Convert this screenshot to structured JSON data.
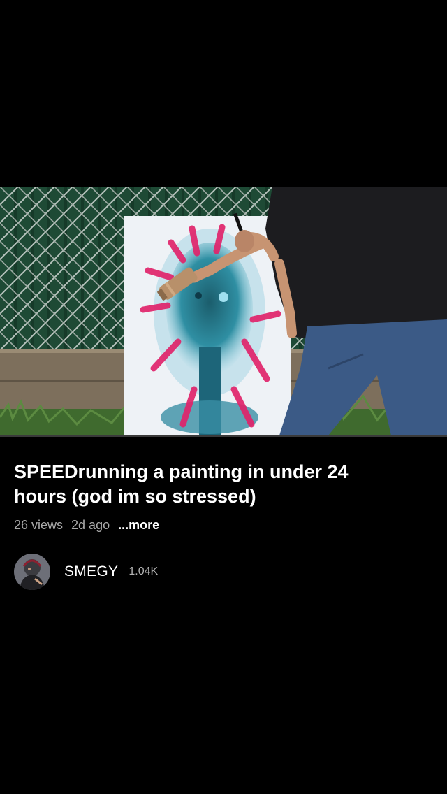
{
  "video": {
    "title": "SPEEDrunning a painting in under 24 hours (god im so stressed)",
    "views": "26 views",
    "age": "2d ago",
    "more_label": "...more",
    "progress": 0
  },
  "channel": {
    "name": "SMEGY",
    "subscribers": "1.04K"
  },
  "colors": {
    "background": "#000000",
    "title": "#ffffff",
    "meta": "#a9a9a9",
    "progress_track": "#3a3a3a",
    "progress_played": "#ff0000"
  }
}
